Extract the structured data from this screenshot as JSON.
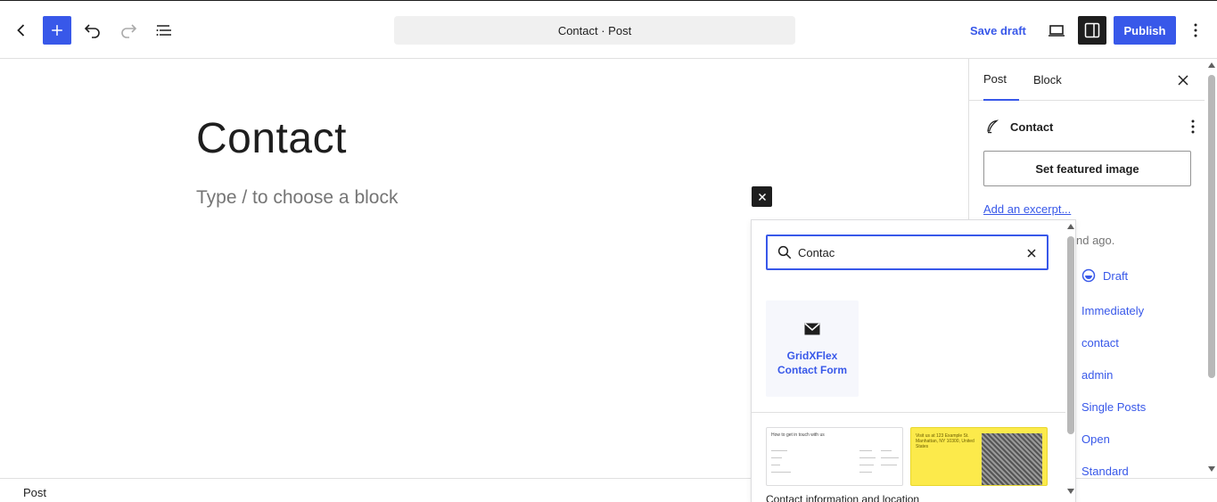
{
  "header": {
    "doc_title": "Contact · Post",
    "save_draft": "Save draft",
    "publish": "Publish"
  },
  "editor": {
    "title": "Contact",
    "block_placeholder": "Type / to choose a block"
  },
  "sidebar": {
    "tabs": [
      "Post",
      "Block"
    ],
    "post_name": "Contact",
    "featured_image_button": "Set featured image",
    "excerpt_link": "Add an excerpt...",
    "saved_text": "nd ago.",
    "status": "Draft",
    "publish_time": "Immediately",
    "slug": "contact",
    "author": "admin",
    "template": "Single Posts",
    "discussion": "Open",
    "format": "Standard"
  },
  "inserter": {
    "search_value": "Contac",
    "block_result": "GridXFlex Contact Form",
    "pattern_a": {
      "title": "How to get in touch with us"
    },
    "pattern_b": {
      "text": "Visit us at 123 Example St. Manhattan, NY 10300, United States"
    },
    "pattern_label": "Contact information and location"
  },
  "footer": {
    "breadcrumb": "Post"
  },
  "colors": {
    "accent": "#3858e9",
    "dark": "#1e1e1e",
    "pattern_yellow": "#fcea4b"
  }
}
